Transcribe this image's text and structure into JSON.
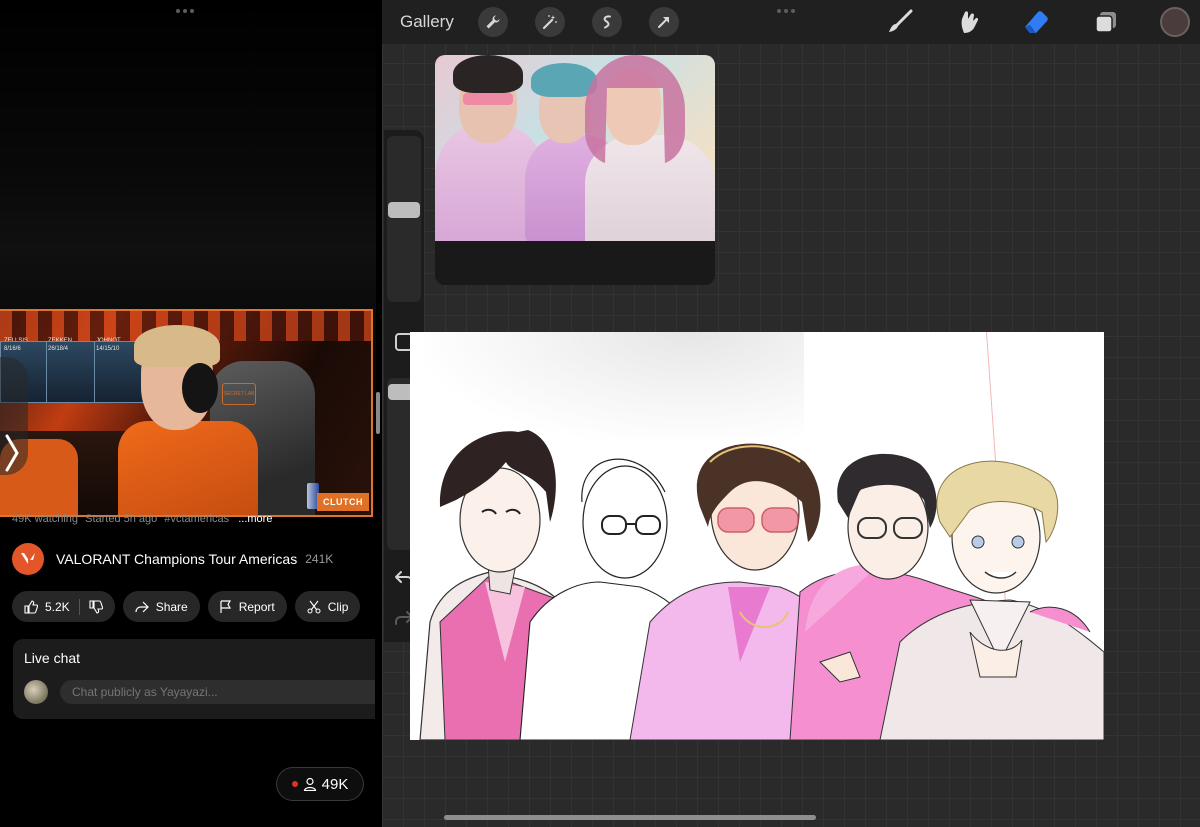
{
  "youtube": {
    "video": {
      "overlay_badge": "CLUTCH",
      "panel_labels": [
        "ZELLSIS",
        "ZEKKEN",
        "JOHNQT"
      ],
      "panel_stats": [
        "8/16/6",
        "26/18/4",
        "14/15/10"
      ],
      "chair_logo": "SECRET LAB"
    },
    "meta": {
      "watching": "49K watching",
      "started": "Started 5h ago",
      "hashtag": "#vctamericas",
      "more": "...more"
    },
    "channel": {
      "name": "VALORANT Champions Tour Americas",
      "subscribers": "241K"
    },
    "actions": {
      "likes": "5.2K",
      "share": "Share",
      "report": "Report",
      "clip": "Clip"
    },
    "live_chat": {
      "title": "Live chat",
      "placeholder": "Chat publicly as Yayayazi..."
    },
    "viewer_count": "49K"
  },
  "procreate": {
    "toolbar": {
      "gallery": "Gallery",
      "left_tools": [
        "wrench-icon",
        "magic-wand-icon",
        "selection-icon",
        "transform-arrow-icon"
      ],
      "right_tools": [
        "brush-icon",
        "smudge-icon",
        "eraser-icon",
        "layers-icon"
      ],
      "active_tool": "eraser-icon",
      "active_color": "#4a3c3c",
      "accent": "#2f7cf6"
    }
  }
}
